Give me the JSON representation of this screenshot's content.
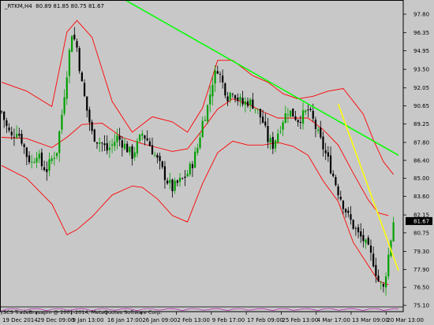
{
  "header": {
    "symbol": "_RTKM,H4",
    "ohlc": "80.89 81.85 80.75 81.67"
  },
  "footer": {
    "copyright": "SCS TradeBrasapm @ 2001-2014, MetaQuotes Software Corp."
  },
  "colors": {
    "background": "#c8c8c8",
    "candle_bull": "#00a000",
    "candle_bear": "#000000",
    "bands": "#ff0000",
    "trendline_main": "#00ff00",
    "trendline_secondary": "#ffff00",
    "current_price_box": "#000000"
  },
  "chart_data": {
    "type": "candlestick",
    "title": "",
    "y_axis": {
      "ticks": [
        "97.80",
        "96.35",
        "94.95",
        "93.50",
        "92.05",
        "90.65",
        "89.25",
        "87.80",
        "86.40",
        "85.00",
        "83.60",
        "82.15",
        "80.75",
        "79.30",
        "77.90",
        "76.50",
        "75.10"
      ],
      "ylim": [
        75.1,
        97.8
      ],
      "current_price": "81.67"
    },
    "x_axis": {
      "ticks": [
        "19 Dec 2014",
        "29 Dec 09:00",
        "9 Jan 13:00",
        "16 Jan 17:00",
        "26 Jan 09:00",
        "2 Feb 13:00",
        "9 Feb 17:00",
        "17 Feb 09:00",
        "25 Feb 13:00",
        "4 Mar 17:00",
        "13 Mar 09:00",
        "20 Mar 13:00"
      ]
    },
    "close_path": [
      [
        0,
        90.2
      ],
      [
        2,
        89.0
      ],
      [
        4,
        88.2
      ],
      [
        6,
        88.8
      ],
      [
        8,
        88.0
      ],
      [
        10,
        86.8
      ],
      [
        12,
        86.2
      ],
      [
        14,
        87.0
      ],
      [
        16,
        86.0
      ],
      [
        18,
        85.7
      ],
      [
        20,
        86.5
      ],
      [
        22,
        87.2
      ],
      [
        24,
        90.0
      ],
      [
        26,
        93.3
      ],
      [
        28,
        96.4
      ],
      [
        30,
        95.2
      ],
      [
        32,
        92.3
      ],
      [
        34,
        90.3
      ],
      [
        36,
        88.5
      ],
      [
        38,
        88.0
      ],
      [
        40,
        87.7
      ],
      [
        42,
        87.2
      ],
      [
        44,
        87.6
      ],
      [
        46,
        88.2
      ],
      [
        48,
        87.8
      ],
      [
        50,
        87.3
      ],
      [
        52,
        86.8
      ],
      [
        54,
        87.6
      ],
      [
        56,
        88.5
      ],
      [
        58,
        88.0
      ],
      [
        60,
        87.2
      ],
      [
        62,
        86.4
      ],
      [
        64,
        85.6
      ],
      [
        66,
        84.8
      ],
      [
        68,
        84.2
      ],
      [
        70,
        84.6
      ],
      [
        72,
        84.9
      ],
      [
        74,
        85.4
      ],
      [
        76,
        86.2
      ],
      [
        78,
        87.4
      ],
      [
        80,
        89.4
      ],
      [
        82,
        90.6
      ],
      [
        84,
        92.6
      ],
      [
        86,
        93.6
      ],
      [
        88,
        92.4
      ],
      [
        90,
        91.4
      ],
      [
        92,
        91.9
      ],
      [
        94,
        91.2
      ],
      [
        96,
        90.8
      ],
      [
        98,
        91.0
      ],
      [
        100,
        90.8
      ],
      [
        102,
        90.2
      ],
      [
        104,
        89.4
      ],
      [
        106,
        88.0
      ],
      [
        108,
        87.6
      ],
      [
        110,
        88.6
      ],
      [
        112,
        89.6
      ],
      [
        114,
        90.3
      ],
      [
        116,
        90.0
      ],
      [
        118,
        89.6
      ],
      [
        120,
        89.9
      ],
      [
        122,
        90.3
      ],
      [
        124,
        89.5
      ],
      [
        126,
        88.4
      ],
      [
        128,
        87.4
      ],
      [
        130,
        86.4
      ],
      [
        132,
        85.2
      ],
      [
        134,
        84.0
      ],
      [
        136,
        83.0
      ],
      [
        138,
        82.0
      ],
      [
        140,
        81.3
      ],
      [
        142,
        80.6
      ],
      [
        144,
        80.2
      ],
      [
        146,
        79.4
      ],
      [
        148,
        78.5
      ],
      [
        150,
        77.0
      ],
      [
        152,
        76.4
      ],
      [
        154,
        79.0
      ],
      [
        156,
        81.67
      ]
    ],
    "bands": {
      "upper_path": [
        [
          0,
          92.5
        ],
        [
          10,
          91.8
        ],
        [
          20,
          90.6
        ],
        [
          26,
          96.4
        ],
        [
          30,
          97.3
        ],
        [
          36,
          96.0
        ],
        [
          44,
          91.0
        ],
        [
          52,
          88.6
        ],
        [
          60,
          89.8
        ],
        [
          68,
          89.4
        ],
        [
          74,
          88.6
        ],
        [
          80,
          90.5
        ],
        [
          86,
          94.2
        ],
        [
          92,
          94.2
        ],
        [
          100,
          93.0
        ],
        [
          106,
          92.5
        ],
        [
          112,
          91.6
        ],
        [
          118,
          91.2
        ],
        [
          124,
          91.4
        ],
        [
          130,
          91.8
        ],
        [
          136,
          92.0
        ],
        [
          140,
          91.0
        ],
        [
          144,
          90.0
        ],
        [
          148,
          88.0
        ],
        [
          152,
          86.3
        ],
        [
          156,
          85.3
        ]
      ],
      "middle_path": [
        [
          0,
          88.2
        ],
        [
          10,
          88.1
        ],
        [
          20,
          87.4
        ],
        [
          26,
          88.2
        ],
        [
          32,
          89.2
        ],
        [
          40,
          89.3
        ],
        [
          48,
          88.2
        ],
        [
          56,
          87.7
        ],
        [
          62,
          87.4
        ],
        [
          68,
          87.1
        ],
        [
          74,
          87.3
        ],
        [
          80,
          88.8
        ],
        [
          86,
          90.4
        ],
        [
          92,
          91.2
        ],
        [
          98,
          90.8
        ],
        [
          104,
          90.2
        ],
        [
          110,
          89.7
        ],
        [
          116,
          89.7
        ],
        [
          122,
          89.7
        ],
        [
          128,
          88.8
        ],
        [
          134,
          87.6
        ],
        [
          140,
          85.4
        ],
        [
          146,
          83.3
        ],
        [
          150,
          82.3
        ],
        [
          154,
          82.1
        ]
      ],
      "lower_path": [
        [
          0,
          86.0
        ],
        [
          10,
          85.0
        ],
        [
          20,
          83.0
        ],
        [
          26,
          80.6
        ],
        [
          30,
          81.0
        ],
        [
          36,
          82.0
        ],
        [
          44,
          83.7
        ],
        [
          52,
          84.4
        ],
        [
          56,
          84.3
        ],
        [
          62,
          83.4
        ],
        [
          68,
          82.1
        ],
        [
          74,
          81.6
        ],
        [
          80,
          84.6
        ],
        [
          86,
          87.0
        ],
        [
          92,
          87.9
        ],
        [
          98,
          87.6
        ],
        [
          104,
          87.6
        ],
        [
          110,
          87.8
        ],
        [
          116,
          87.5
        ],
        [
          122,
          86.8
        ],
        [
          128,
          84.8
        ],
        [
          134,
          83.2
        ],
        [
          140,
          80.0
        ],
        [
          146,
          78.2
        ],
        [
          150,
          77.0
        ],
        [
          154,
          76.7
        ]
      ]
    },
    "trendlines": [
      {
        "color": "green",
        "from": [
          34,
          100.6
        ],
        "to": [
          158,
          86.8
        ]
      },
      {
        "color": "yellow",
        "from": [
          134,
          90.8
        ],
        "to": [
          158,
          77.8
        ]
      }
    ]
  }
}
